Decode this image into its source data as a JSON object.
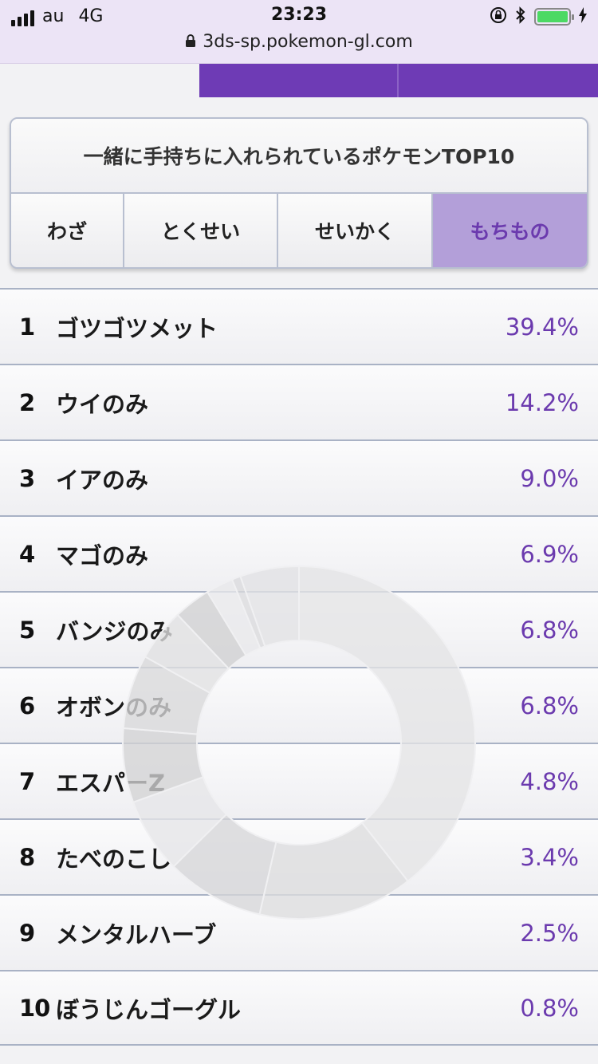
{
  "status": {
    "carrier": "au",
    "network": "4G",
    "time": "23:23",
    "url": "3ds-sp.pokemon-gl.com",
    "battery_color": "#4cd964"
  },
  "panel": {
    "title": "一緒に手持ちに入れられているポケモンTOP10",
    "tabs": [
      {
        "label": "わざ",
        "active": false
      },
      {
        "label": "とくせい",
        "active": false
      },
      {
        "label": "せいかく",
        "active": false
      },
      {
        "label": "もちもの",
        "active": true
      }
    ]
  },
  "items": [
    {
      "rank": "1",
      "name": "ゴツゴツメット",
      "percent": "39.4%",
      "value": 39.4
    },
    {
      "rank": "2",
      "name": "ウイのみ",
      "percent": "14.2%",
      "value": 14.2
    },
    {
      "rank": "3",
      "name": "イアのみ",
      "percent": "9.0%",
      "value": 9.0
    },
    {
      "rank": "4",
      "name": "マゴのみ",
      "percent": "6.9%",
      "value": 6.9
    },
    {
      "rank": "5",
      "name": "バンジのみ",
      "percent": "6.8%",
      "value": 6.8
    },
    {
      "rank": "6",
      "name": "オボンのみ",
      "percent": "6.8%",
      "value": 6.8
    },
    {
      "rank": "7",
      "name": "エスパーZ",
      "percent": "4.8%",
      "value": 4.8
    },
    {
      "rank": "8",
      "name": "たべのこし",
      "percent": "3.4%",
      "value": 3.4
    },
    {
      "rank": "9",
      "name": "メンタルハーブ",
      "percent": "2.5%",
      "value": 2.5
    },
    {
      "rank": "10",
      "name": "ぼうじんゴーグル",
      "percent": "0.8%",
      "value": 0.8
    }
  ],
  "colors": {
    "accent": "#6e3bb5",
    "active_tab": "#b39fd9",
    "percent_text": "#6b3aae"
  }
}
